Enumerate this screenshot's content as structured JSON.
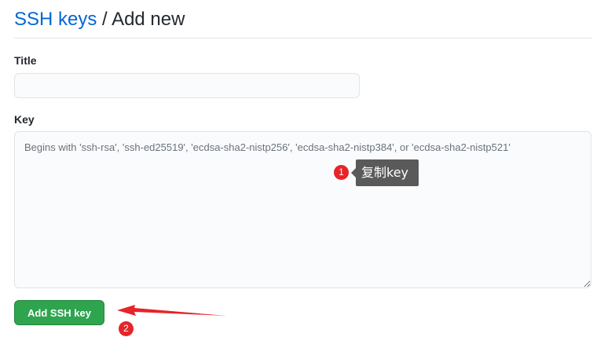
{
  "breadcrumb": {
    "parent": "SSH keys",
    "separator": "/",
    "current": "Add new"
  },
  "form": {
    "title_label": "Title",
    "title_value": "",
    "key_label": "Key",
    "key_placeholder": "Begins with 'ssh-rsa', 'ssh-ed25519', 'ecdsa-sha2-nistp256', 'ecdsa-sha2-nistp384', or 'ecdsa-sha2-nistp521'",
    "submit_label": "Add SSH key"
  },
  "annotations": {
    "step1_number": "1",
    "step1_text": "复制key",
    "step2_number": "2",
    "arrow_color": "#e6242a"
  },
  "colors": {
    "link": "#0366d6",
    "button": "#2ea44f",
    "marker": "#e6242a"
  }
}
